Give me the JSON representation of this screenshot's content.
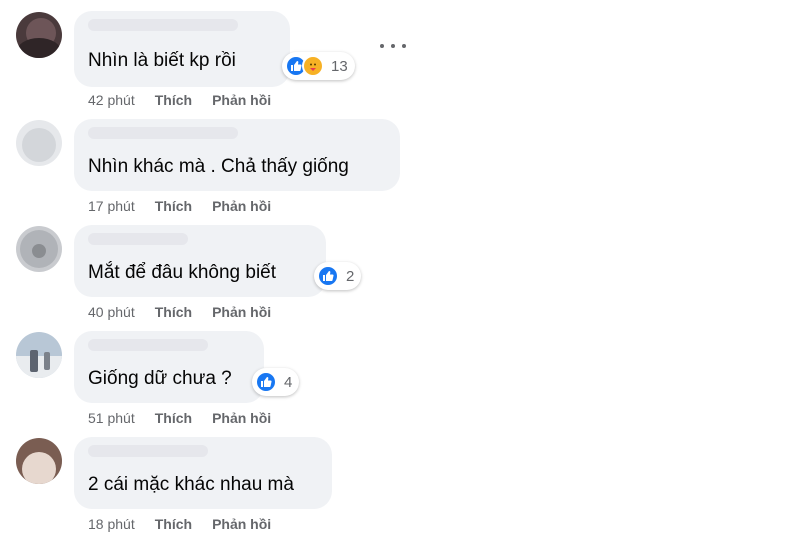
{
  "comments": [
    {
      "text": "Nhìn là biết kp rồi",
      "time": "42 phút",
      "like": "Thích",
      "reply": "Phản hồi",
      "reactions": [
        "like-icon",
        "care-icon"
      ],
      "reaction_count": "13"
    },
    {
      "text": "Nhìn khác mà . Chả thấy giống",
      "time": "17 phút",
      "like": "Thích",
      "reply": "Phản hồi"
    },
    {
      "text": "Mắt để đâu không biết",
      "time": "40 phút",
      "like": "Thích",
      "reply": "Phản hồi",
      "reactions": [
        "like-icon"
      ],
      "reaction_count": "2"
    },
    {
      "text": "Giống dữ chưa ?",
      "time": "51 phút",
      "like": "Thích",
      "reply": "Phản hồi",
      "reactions": [
        "like-icon"
      ],
      "reaction_count": "4"
    },
    {
      "text": "2 cái mặc khác nhau mà",
      "time": "18 phút",
      "like": "Thích",
      "reply": "Phản hồi"
    }
  ],
  "colors": {
    "like": "#1877f2",
    "bubble": "#f0f2f5",
    "meta": "#65676b"
  },
  "more_icon": "more-options-icon"
}
